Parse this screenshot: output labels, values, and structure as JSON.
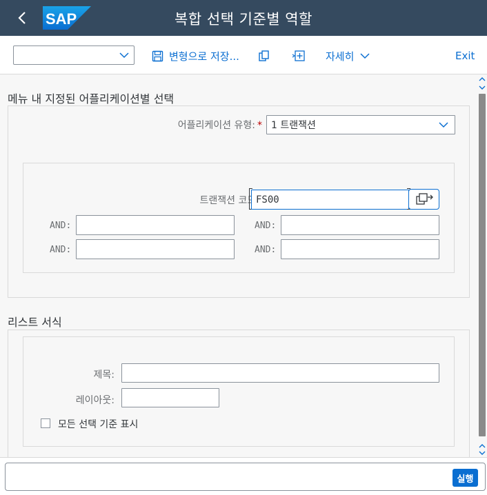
{
  "shell": {
    "title": "복합 선택 기준별 역할",
    "logo_text": "SAP",
    "brand_color": "#0a6ed1",
    "header_color": "#354a5f"
  },
  "toolbar": {
    "variant_value": "",
    "save_label": "변형으로 저장...",
    "detail_label": "자세히",
    "exit_label": "Exit"
  },
  "section_menu": {
    "title": "메뉴 내 지정된 어플리케이션별 선택",
    "app_type_label": "어플리케이션 유형:",
    "app_type_value": "1 트랜잭션",
    "tcode_label": "트랜잭션 코드:",
    "tcode_value": "FS00",
    "and_label": "AND:",
    "and_fields": [
      "",
      "",
      "",
      ""
    ]
  },
  "section_list": {
    "title": "리스트 서식",
    "title_label": "제목:",
    "title_value": "",
    "layout_label": "레이아웃:",
    "layout_value": "",
    "show_all_label": "모든 선택 기준 표시",
    "show_all_checked": false
  },
  "footer": {
    "command_value": "",
    "run_label": "실행"
  }
}
